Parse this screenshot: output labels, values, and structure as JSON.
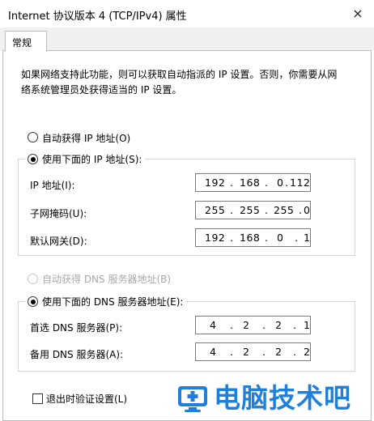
{
  "window": {
    "title": "Internet 协议版本 4 (TCP/IPv4) 属性",
    "close_glyph": "×"
  },
  "tabs": [
    {
      "label": "常规",
      "active": true
    }
  ],
  "description": {
    "line1": "如果网络支持此功能，则可以获取自动指派的 IP 设置。否则，你需要从网",
    "line2": "络系统管理员处获得适当的 IP 设置。"
  },
  "ip_mode": {
    "auto_label": "自动获得 IP 地址(O)",
    "manual_label": "使用下面的 IP 地址(S):",
    "selected": "manual"
  },
  "ip_fields": {
    "ip": {
      "label": "IP 地址(I):",
      "octets": [
        "192",
        "168",
        "0",
        "112"
      ]
    },
    "subnet": {
      "label": "子网掩码(U):",
      "octets": [
        "255",
        "255",
        "255",
        "0"
      ]
    },
    "gateway": {
      "label": "默认网关(D):",
      "octets": [
        "192",
        "168",
        "0",
        "1"
      ]
    }
  },
  "dns_mode": {
    "auto_label": "自动获得 DNS 服务器地址(B)",
    "auto_disabled": true,
    "manual_label": "使用下面的 DNS 服务器地址(E):",
    "selected": "manual"
  },
  "dns_fields": {
    "preferred": {
      "label": "首选 DNS 服务器(P):",
      "octets": [
        "4",
        "2",
        "2",
        "1"
      ]
    },
    "alternate": {
      "label": "备用 DNS 服务器(A):",
      "octets": [
        "4",
        "2",
        "2",
        "2"
      ]
    }
  },
  "validate_on_exit": {
    "label": "退出时验证设置(L)",
    "checked": false
  },
  "watermark": {
    "text": "电脑技术吧",
    "icon": "monitor-plus-icon",
    "color": "#1e7fdc"
  }
}
